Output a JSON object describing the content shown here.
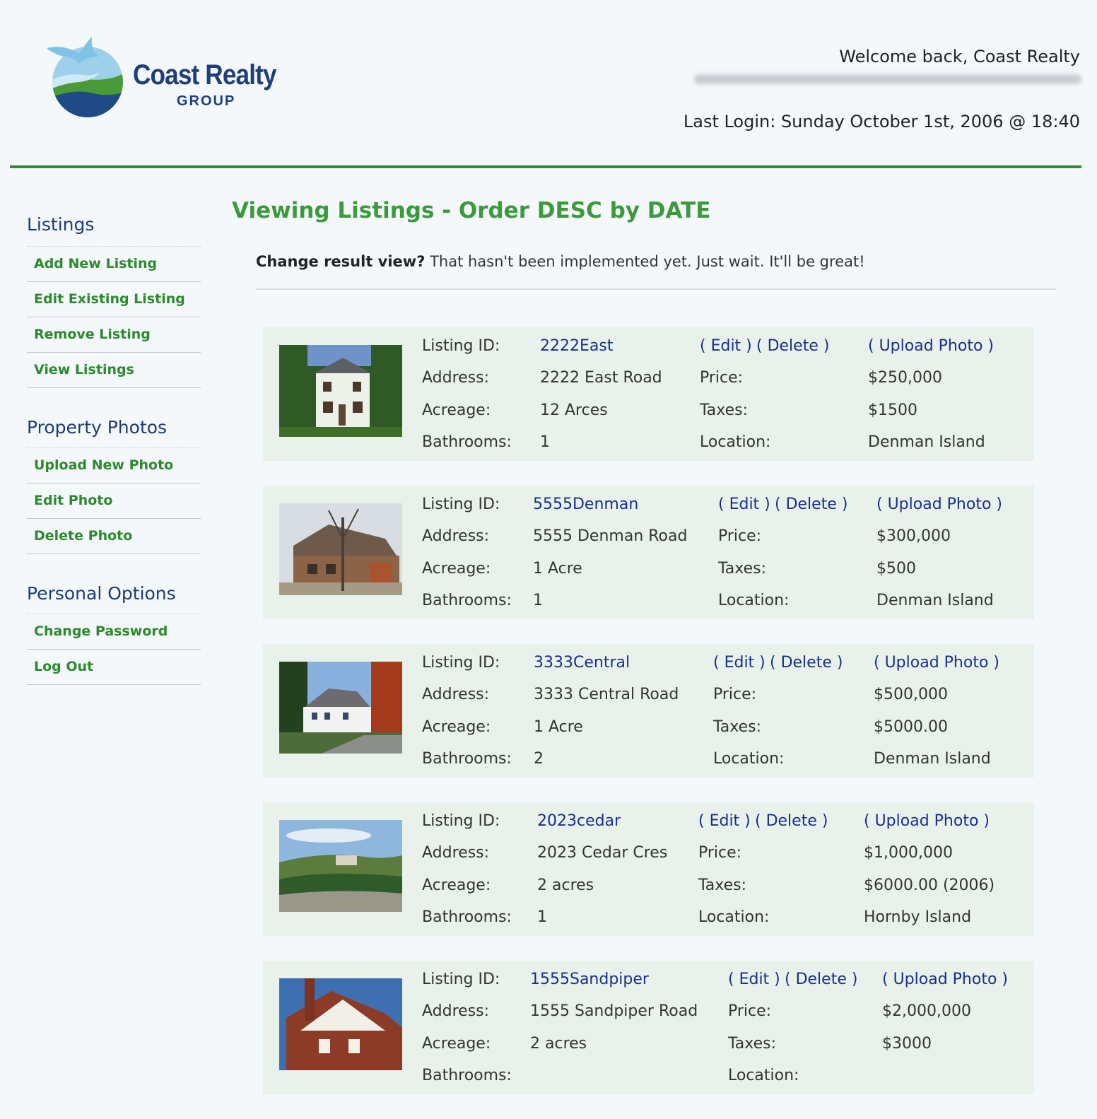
{
  "brand": {
    "name": "Coast Realty",
    "sub": "GROUP"
  },
  "header": {
    "welcome": "Welcome back, Coast Realty",
    "last_login": "Last Login: Sunday October 1st, 2006 @ 18:40"
  },
  "sidebar": {
    "groups": [
      {
        "heading": "Listings",
        "items": [
          "Add New Listing",
          "Edit Existing Listing",
          "Remove Listing",
          "View Listings"
        ]
      },
      {
        "heading": "Property Photos",
        "items": [
          "Upload New Photo",
          "Edit Photo",
          "Delete Photo"
        ]
      },
      {
        "heading": "Personal Options",
        "items": [
          "Change Password",
          "Log Out"
        ]
      }
    ]
  },
  "main": {
    "title": "Viewing Listings - Order DESC by DATE",
    "notice_label": "Change result view?",
    "notice_text": " That hasn't been implemented yet. Just wait. It'll be great!"
  },
  "labels": {
    "listing_id": "Listing ID:",
    "address": "Address:",
    "acreage": "Acreage:",
    "bathrooms": "Bathrooms:",
    "price": "Price:",
    "taxes": "Taxes:",
    "location": "Location:",
    "edit": "( Edit )",
    "delete": "( Delete )",
    "upload": "( Upload Photo )"
  },
  "listings": [
    {
      "id": "2222East",
      "address": "2222 East Road",
      "acreage": "12 Arces",
      "bathrooms": "1",
      "price": "$250,000",
      "taxes": "$1500",
      "location": "Denman Island",
      "photo": "white-two-storey-house"
    },
    {
      "id": "5555Denman",
      "address": "5555 Denman Road",
      "acreage": "1 Acre",
      "bathrooms": "1",
      "price": "$300,000",
      "taxes": "$500",
      "location": "Denman Island",
      "photo": "brick-house-with-tree"
    },
    {
      "id": "3333Central",
      "address": "3333 Central Road",
      "acreage": "1 Acre",
      "bathrooms": "2",
      "price": "$500,000",
      "taxes": "$5000.00",
      "location": "Denman Island",
      "photo": "white-farmhouse-autumn"
    },
    {
      "id": "2023cedar",
      "address": "2023 Cedar Cres",
      "acreage": "2 acres",
      "bathrooms": "1",
      "price": "$1,000,000",
      "taxes": "$6000.00 (2006)",
      "location": "Hornby Island",
      "photo": "hillside-landscape"
    },
    {
      "id": "1555Sandpiper",
      "address": "1555 Sandpiper Road",
      "acreage": "2 acres",
      "bathrooms": "",
      "price": "$2,000,000",
      "taxes": "$3000",
      "location": "",
      "photo": "red-brick-house"
    }
  ]
}
